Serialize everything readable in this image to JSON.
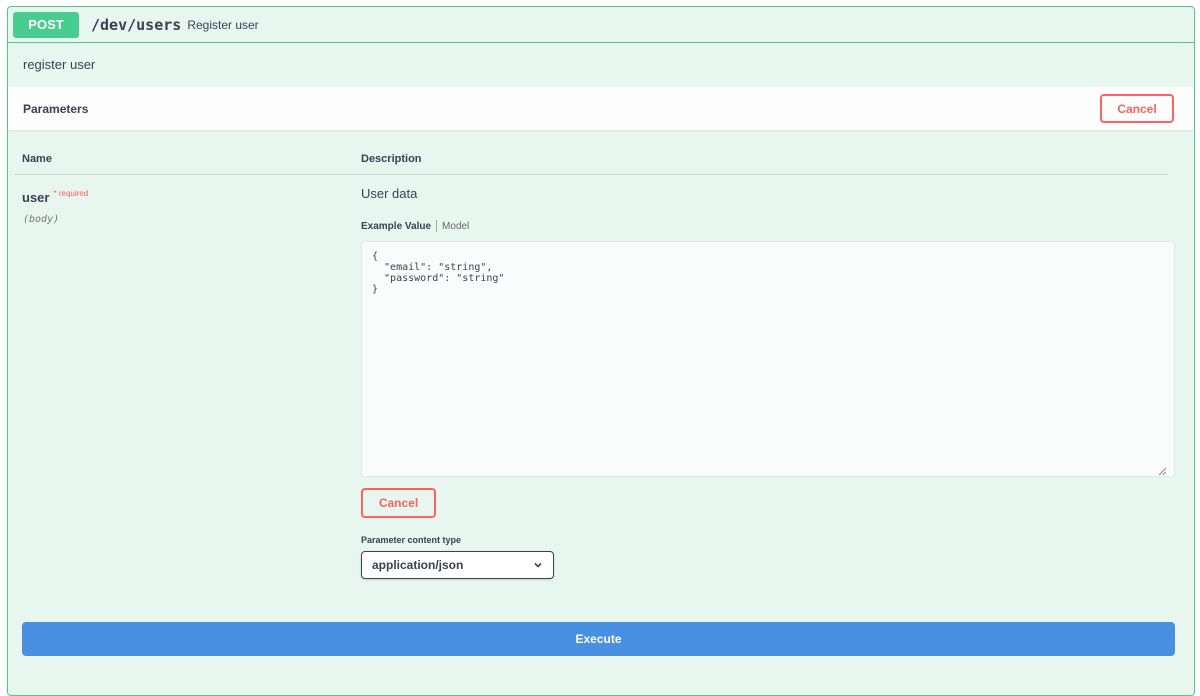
{
  "operation": {
    "method": "POST",
    "path": "/dev/users",
    "summary": "Register user",
    "description": "register user"
  },
  "parameters_section": {
    "title": "Parameters",
    "cancel_label": "Cancel"
  },
  "columns": {
    "name": "Name",
    "description": "Description"
  },
  "parameter": {
    "name": "user",
    "required_mark": "*",
    "required_label": "required",
    "in": "(body)",
    "description": "User data"
  },
  "example_tabs": {
    "active": "Example Value",
    "other": "Model"
  },
  "body_value": "{\n  \"email\": \"string\",\n  \"password\": \"string\"\n}",
  "body_cancel_label": "Cancel",
  "content_type": {
    "label": "Parameter content type",
    "selected": "application/json"
  },
  "execute_label": "Execute",
  "colors": {
    "post_green": "#49cc90",
    "background": "#e8f6f0",
    "cancel_red": "#ff6060",
    "execute_blue": "#4990e2"
  },
  "icons": {
    "select_arrow": "chevron-down-icon",
    "textarea_resize": "resize-handle-icon"
  }
}
